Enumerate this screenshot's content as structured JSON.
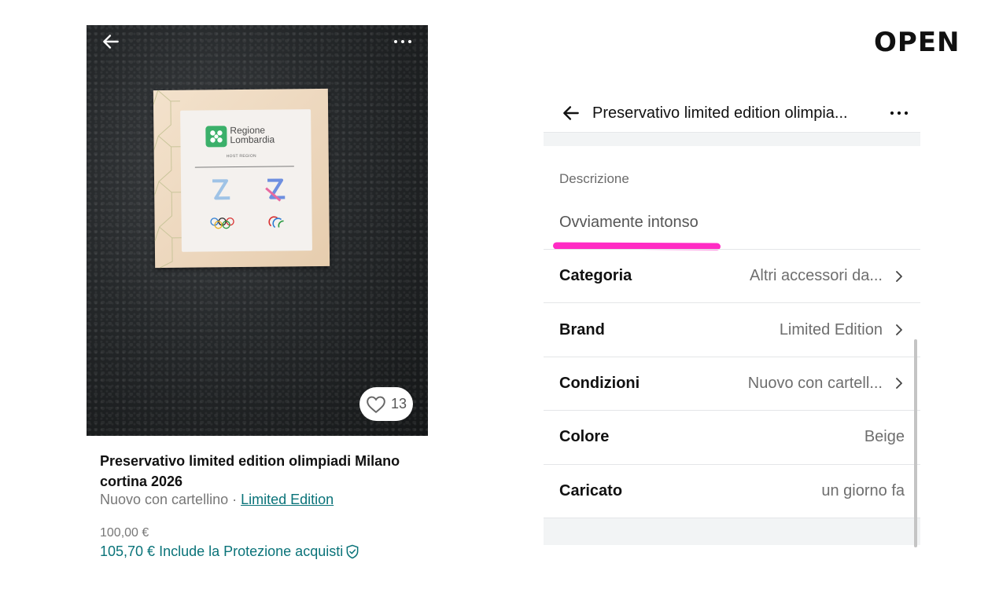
{
  "colors": {
    "accent_teal": "#0a7379",
    "highlight_pink": "#ff2bc4",
    "muted_text": "#6e6e6e",
    "divider": "#e4e6e8"
  },
  "branding": {
    "logo_text": "OPEN"
  },
  "listing": {
    "photo": {
      "back_icon": "arrow-left-icon",
      "more_icon": "more-horizontal-icon",
      "product_label": {
        "line1": "Regione",
        "line2": "Lombardia",
        "host": "HOST REGION"
      },
      "likes": "13",
      "carousel_pages": 2,
      "carousel_active": 1
    },
    "title": "Preservativo limited edition olimpiadi Milano cortina 2026",
    "condition": "Nuovo con cartellino",
    "separator": " · ",
    "brand": "Limited Edition",
    "price": "100,00 €",
    "price_protected": "105,70 € Include la Protezione acquisti"
  },
  "details": {
    "header_title": "Preservativo limited edition olimpia...",
    "description_label": "Descrizione",
    "description_text": "Ovviamente intonso",
    "rows": [
      {
        "label": "Categoria",
        "value": "Altri accessori da...",
        "chevron": true
      },
      {
        "label": "Brand",
        "value": "Limited Edition",
        "chevron": true
      },
      {
        "label": "Condizioni",
        "value": "Nuovo con cartell...",
        "chevron": true
      },
      {
        "label": "Colore",
        "value": "Beige",
        "chevron": false
      },
      {
        "label": "Caricato",
        "value": "un giorno fa",
        "chevron": false
      }
    ]
  }
}
